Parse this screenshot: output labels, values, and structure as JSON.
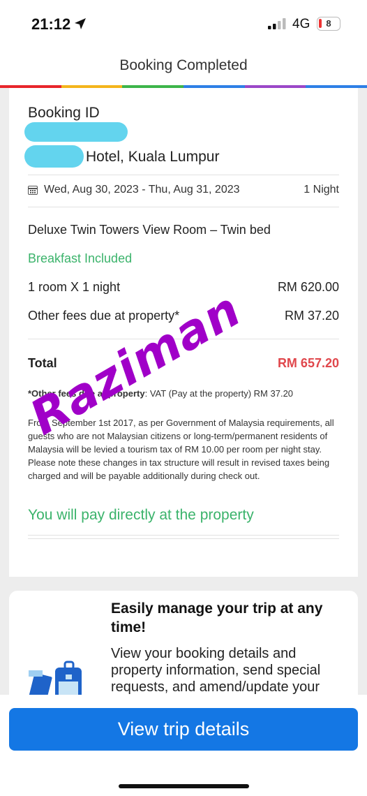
{
  "status_bar": {
    "time": "21:12",
    "network": "4G",
    "battery": "8"
  },
  "header": {
    "title": "Booking Completed"
  },
  "colors": {
    "accent": "#1477e4",
    "green": "#3bb36b",
    "total_red": "#e0474c",
    "rainbow": [
      "#e8262b",
      "#f4b51c",
      "#3db54a",
      "#2e7fe6",
      "#9b47c8",
      "#2e7fe6"
    ]
  },
  "booking": {
    "id_label": "Booking ID",
    "hotel_visible": "Hotel, Kuala Lumpur",
    "dates": "Wed, Aug 30, 2023 - Thu, Aug 31, 2023",
    "nights": "1 Night",
    "room_type": "Deluxe Twin Towers View Room – Twin bed",
    "breakfast": "Breakfast Included",
    "room_line_label": "1 room  X 1 night",
    "room_line_value": "RM 620.00",
    "fees_label": "Other fees due at property*",
    "fees_value": "RM 37.20",
    "total_label": "Total",
    "total_value": "RM 657.20",
    "fee_note_bold": "*Other fees due at property",
    "fee_note_rest": ": VAT (Pay at the property) RM 37.20",
    "tax_note": "From September 1st 2017, as per Government of Malaysia requirements, all guests who are not Malaysian citizens or long-term/permanent residents of Malaysia will be levied a tourism tax of RM 10.00 per room per night stay. Please note these changes in tax structure will result in revised taxes being charged and will be payable additionally during check out.",
    "pay_note": "You will pay directly at the property"
  },
  "watermark": "Raziman",
  "manage": {
    "title": "Easily manage your trip at any time!",
    "body": "View your booking details and property information, send special requests, and amend/update your"
  },
  "button": {
    "label": "View trip details"
  }
}
